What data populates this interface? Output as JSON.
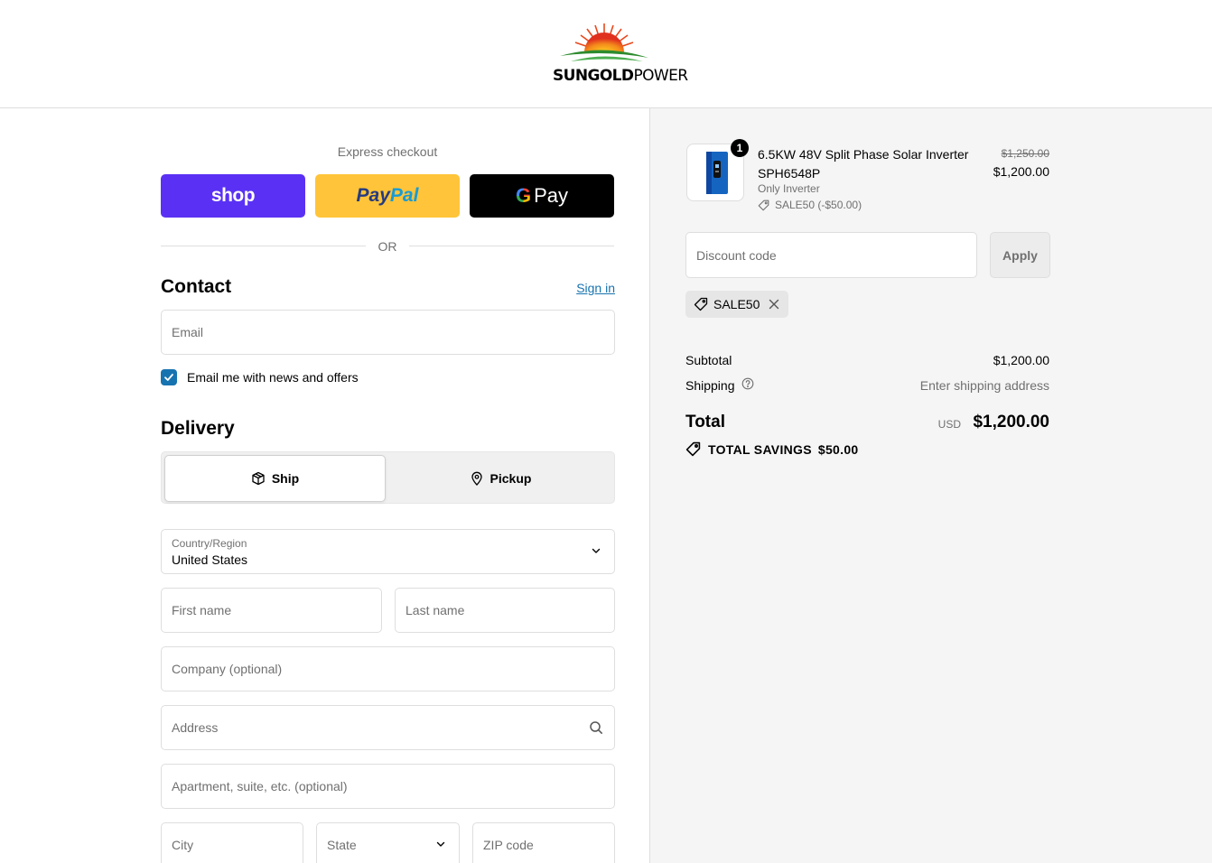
{
  "header": {
    "logo_bold": "SUNGOLD",
    "logo_light": "POWER"
  },
  "express": {
    "title": "Express checkout",
    "shop_label": "shop",
    "paypal_label_a": "Pay",
    "paypal_label_b": "Pal",
    "gpay_g": "G",
    "gpay_label": "Pay",
    "or_text": "OR"
  },
  "contact": {
    "heading": "Contact",
    "signin_label": "Sign in",
    "email_placeholder": "Email",
    "news_checkbox_checked": true,
    "news_label": "Email me with news and offers"
  },
  "delivery": {
    "heading": "Delivery",
    "ship_label": "Ship",
    "pickup_label": "Pickup",
    "selected": "Ship",
    "country_label": "Country/Region",
    "country_value": "United States",
    "first_name_placeholder": "First name",
    "last_name_placeholder": "Last name",
    "company_placeholder": "Company (optional)",
    "address_placeholder": "Address",
    "apartment_placeholder": "Apartment, suite, etc. (optional)",
    "city_placeholder": "City",
    "state_placeholder": "State",
    "zip_placeholder": "ZIP code"
  },
  "summary": {
    "item": {
      "quantity": "1",
      "name": "6.5KW 48V Split Phase Solar Inverter SPH6548P",
      "variant": "Only Inverter",
      "discount": "SALE50 (-$50.00)",
      "original_price": "$1,250.00",
      "price": "$1,200.00"
    },
    "discount_placeholder": "Discount code",
    "apply_label": "Apply",
    "applied_code": "SALE50",
    "subtotal_label": "Subtotal",
    "subtotal_value": "$1,200.00",
    "shipping_label": "Shipping",
    "shipping_value": "Enter shipping address",
    "total_label": "Total",
    "currency": "USD",
    "total_value": "$1,200.00",
    "savings_label": "TOTAL SAVINGS",
    "savings_value": "$50.00"
  },
  "colors": {
    "accent": "#1773b0",
    "shop_purple": "#5a31f4",
    "paypal_yellow": "#ffc439",
    "summary_bg": "#f5f5f5"
  },
  "icons": [
    "sun-logo-icon",
    "cube-icon",
    "location-pin-icon",
    "chevron-down-icon",
    "search-icon",
    "checkmark-icon",
    "discount-tag-icon",
    "close-icon",
    "help-circle-icon"
  ]
}
